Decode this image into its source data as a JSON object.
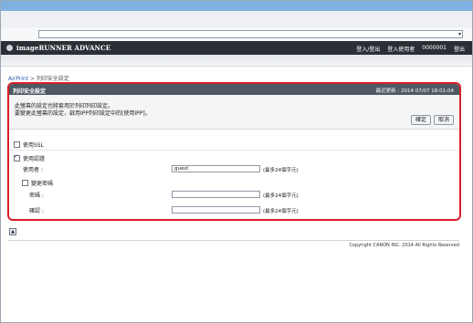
{
  "header": {
    "app_name": "imageRUNNER ADVANCE",
    "login_link": "登入/登出",
    "user_label": "登入使用者",
    "user_id": "0000001",
    "logout": "登出"
  },
  "breadcrumb": {
    "root": "AirPrint",
    "sep": " > ",
    "current": "列印安全設定"
  },
  "panel": {
    "title": "列印安全設定",
    "last_updated": "最近更新 : 2014 07/07 18:01:04",
    "message_line1": "此螢幕的設定也將套用於列印列印設定。",
    "message_line2": "要變更此螢幕的設定，啟用IPP列印設定中的[使用IPP]。",
    "ok_button": "確定",
    "cancel_button": "取消",
    "use_ssl_label": "使用SSL",
    "use_ssl_checked": false,
    "use_auth_label": "使用認證",
    "use_auth_checked": true,
    "user_label": "使用者 :",
    "user_value": "guest",
    "user_hint": "(最多24個字元)",
    "change_password_label": "變更密碼",
    "change_password_checked": false,
    "password_label": "密碼 :",
    "password_hint": "(最多24個字元)",
    "confirm_label": "確認 :",
    "confirm_hint": "(最多24個字元)"
  },
  "footer": {
    "copyright": "Copyright CANON INC. 2014 All Rights Reserved"
  }
}
